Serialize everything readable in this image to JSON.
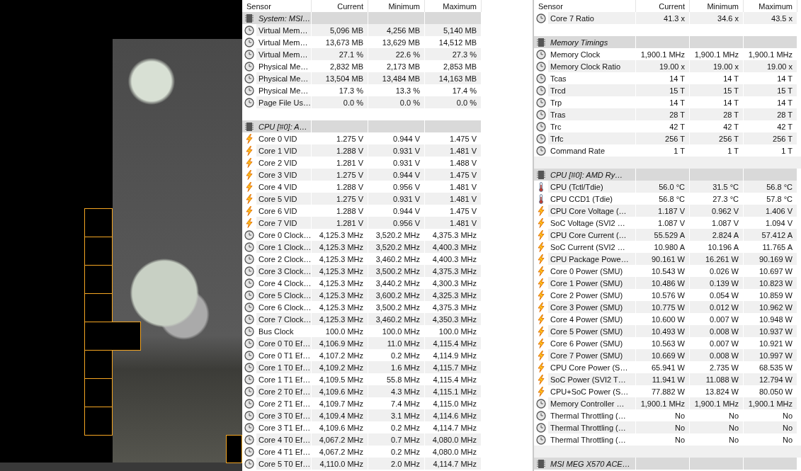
{
  "panels": [
    {
      "first_row_shaded": false,
      "columns": [
        "Sensor",
        "Current",
        "Minimum",
        "Maximum"
      ],
      "rows": [
        {
          "kind": "group",
          "name": "System: MSI…"
        },
        {
          "kind": "clock",
          "name": "Virtual Mem…",
          "current": "5,096 MB",
          "minimum": "4,256 MB",
          "maximum": "5,140 MB"
        },
        {
          "kind": "clock",
          "name": "Virtual Mem…",
          "current": "13,673 MB",
          "minimum": "13,629 MB",
          "maximum": "14,512 MB"
        },
        {
          "kind": "clock",
          "name": "Virtual Mem…",
          "current": "27.1 %",
          "minimum": "22.6 %",
          "maximum": "27.3 %"
        },
        {
          "kind": "clock",
          "name": "Physical Me…",
          "current": "2,832 MB",
          "minimum": "2,173 MB",
          "maximum": "2,853 MB"
        },
        {
          "kind": "clock",
          "name": "Physical Me…",
          "current": "13,504 MB",
          "minimum": "13,484 MB",
          "maximum": "14,163 MB"
        },
        {
          "kind": "clock",
          "name": "Physical Me…",
          "current": "17.3 %",
          "minimum": "13.3 %",
          "maximum": "17.4 %"
        },
        {
          "kind": "clock",
          "name": "Page File Us…",
          "current": "0.0 %",
          "minimum": "0.0 %",
          "maximum": "0.0 %"
        },
        {
          "kind": "blank"
        },
        {
          "kind": "group",
          "name": "CPU [#0]: A…"
        },
        {
          "kind": "voltage",
          "name": "Core 0 VID",
          "current": "1.275 V",
          "minimum": "0.944 V",
          "maximum": "1.475 V"
        },
        {
          "kind": "voltage",
          "name": "Core 1 VID",
          "current": "1.288 V",
          "minimum": "0.931 V",
          "maximum": "1.481 V"
        },
        {
          "kind": "voltage",
          "name": "Core 2 VID",
          "current": "1.281 V",
          "minimum": "0.931 V",
          "maximum": "1.488 V"
        },
        {
          "kind": "voltage",
          "name": "Core 3 VID",
          "current": "1.275 V",
          "minimum": "0.944 V",
          "maximum": "1.475 V"
        },
        {
          "kind": "voltage",
          "name": "Core 4 VID",
          "current": "1.288 V",
          "minimum": "0.956 V",
          "maximum": "1.481 V"
        },
        {
          "kind": "voltage",
          "name": "Core 5 VID",
          "current": "1.275 V",
          "minimum": "0.931 V",
          "maximum": "1.481 V"
        },
        {
          "kind": "voltage",
          "name": "Core 6 VID",
          "current": "1.288 V",
          "minimum": "0.944 V",
          "maximum": "1.475 V"
        },
        {
          "kind": "voltage",
          "name": "Core 7 VID",
          "current": "1.281 V",
          "minimum": "0.956 V",
          "maximum": "1.481 V"
        },
        {
          "kind": "clock",
          "name": "Core 0 Clock…",
          "current": "4,125.3 MHz",
          "minimum": "3,520.2 MHz",
          "maximum": "4,375.3 MHz"
        },
        {
          "kind": "clock",
          "name": "Core 1 Clock…",
          "current": "4,125.3 MHz",
          "minimum": "3,520.2 MHz",
          "maximum": "4,400.3 MHz"
        },
        {
          "kind": "clock",
          "name": "Core 2 Clock…",
          "current": "4,125.3 MHz",
          "minimum": "3,460.2 MHz",
          "maximum": "4,400.3 MHz"
        },
        {
          "kind": "clock",
          "name": "Core 3 Clock…",
          "current": "4,125.3 MHz",
          "minimum": "3,500.2 MHz",
          "maximum": "4,375.3 MHz"
        },
        {
          "kind": "clock",
          "name": "Core 4 Clock…",
          "current": "4,125.3 MHz",
          "minimum": "3,440.2 MHz",
          "maximum": "4,300.3 MHz"
        },
        {
          "kind": "clock",
          "name": "Core 5 Clock…",
          "current": "4,125.3 MHz",
          "minimum": "3,600.2 MHz",
          "maximum": "4,325.3 MHz"
        },
        {
          "kind": "clock",
          "name": "Core 6 Clock…",
          "current": "4,125.3 MHz",
          "minimum": "3,500.2 MHz",
          "maximum": "4,375.3 MHz"
        },
        {
          "kind": "clock",
          "name": "Core 7 Clock…",
          "current": "4,125.3 MHz",
          "minimum": "3,460.2 MHz",
          "maximum": "4,350.3 MHz"
        },
        {
          "kind": "clock",
          "name": "Bus Clock",
          "current": "100.0 MHz",
          "minimum": "100.0 MHz",
          "maximum": "100.0 MHz"
        },
        {
          "kind": "clock",
          "name": "Core 0 T0 Ef…",
          "current": "4,106.9 MHz",
          "minimum": "11.0 MHz",
          "maximum": "4,115.4 MHz"
        },
        {
          "kind": "clock",
          "name": "Core 0 T1 Ef…",
          "current": "4,107.2 MHz",
          "minimum": "0.2 MHz",
          "maximum": "4,114.9 MHz"
        },
        {
          "kind": "clock",
          "name": "Core 1 T0 Ef…",
          "current": "4,109.2 MHz",
          "minimum": "1.6 MHz",
          "maximum": "4,115.7 MHz"
        },
        {
          "kind": "clock",
          "name": "Core 1 T1 Ef…",
          "current": "4,109.5 MHz",
          "minimum": "55.8 MHz",
          "maximum": "4,115.4 MHz"
        },
        {
          "kind": "clock",
          "name": "Core 2 T0 Ef…",
          "current": "4,109.6 MHz",
          "minimum": "4.3 MHz",
          "maximum": "4,115.1 MHz"
        },
        {
          "kind": "clock",
          "name": "Core 2 T1 Ef…",
          "current": "4,109.7 MHz",
          "minimum": "7.4 MHz",
          "maximum": "4,115.0 MHz"
        },
        {
          "kind": "clock",
          "name": "Core 3 T0 Ef…",
          "current": "4,109.4 MHz",
          "minimum": "3.1 MHz",
          "maximum": "4,114.6 MHz"
        },
        {
          "kind": "clock",
          "name": "Core 3 T1 Ef…",
          "current": "4,109.6 MHz",
          "minimum": "0.2 MHz",
          "maximum": "4,114.7 MHz"
        },
        {
          "kind": "clock",
          "name": "Core 4 T0 Ef…",
          "current": "4,067.2 MHz",
          "minimum": "0.7 MHz",
          "maximum": "4,080.0 MHz"
        },
        {
          "kind": "clock",
          "name": "Core 4 T1 Ef…",
          "current": "4,067.2 MHz",
          "minimum": "0.2 MHz",
          "maximum": "4,080.0 MHz"
        },
        {
          "kind": "clock",
          "name": "Core 5 T0 Ef…",
          "current": "4,110.0 MHz",
          "minimum": "2.0 MHz",
          "maximum": "4,114.7 MHz"
        }
      ]
    },
    {
      "first_row_shaded": true,
      "columns": [
        "Sensor",
        "Current",
        "Minimum",
        "Maximum"
      ],
      "rows": [
        {
          "kind": "clock",
          "name": "Core 7 Ratio",
          "current": "41.3 x",
          "minimum": "34.6 x",
          "maximum": "43.5 x"
        },
        {
          "kind": "blank"
        },
        {
          "kind": "group",
          "name": "Memory Timings"
        },
        {
          "kind": "clock",
          "name": "Memory Clock",
          "current": "1,900.1 MHz",
          "minimum": "1,900.1 MHz",
          "maximum": "1,900.1 MHz"
        },
        {
          "kind": "clock",
          "name": "Memory Clock Ratio",
          "current": "19.00 x",
          "minimum": "19.00 x",
          "maximum": "19.00 x"
        },
        {
          "kind": "clock",
          "name": "Tcas",
          "current": "14 T",
          "minimum": "14 T",
          "maximum": "14 T"
        },
        {
          "kind": "clock",
          "name": "Trcd",
          "current": "15 T",
          "minimum": "15 T",
          "maximum": "15 T"
        },
        {
          "kind": "clock",
          "name": "Trp",
          "current": "14 T",
          "minimum": "14 T",
          "maximum": "14 T"
        },
        {
          "kind": "clock",
          "name": "Tras",
          "current": "28 T",
          "minimum": "28 T",
          "maximum": "28 T"
        },
        {
          "kind": "clock",
          "name": "Trc",
          "current": "42 T",
          "minimum": "42 T",
          "maximum": "42 T"
        },
        {
          "kind": "clock",
          "name": "Trfc",
          "current": "256 T",
          "minimum": "256 T",
          "maximum": "256 T"
        },
        {
          "kind": "clock",
          "name": "Command Rate",
          "current": "1 T",
          "minimum": "1 T",
          "maximum": "1 T"
        },
        {
          "kind": "blank"
        },
        {
          "kind": "group",
          "name": "CPU [#0]: AMD Ry…"
        },
        {
          "kind": "temperature",
          "name": "CPU (Tctl/Tdie)",
          "current": "56.0 °C",
          "minimum": "31.5 °C",
          "maximum": "56.8 °C"
        },
        {
          "kind": "temperature",
          "name": "CPU CCD1 (Tdie)",
          "current": "56.8 °C",
          "minimum": "27.3 °C",
          "maximum": "57.8 °C"
        },
        {
          "kind": "voltage",
          "name": "CPU Core Voltage (…",
          "current": "1.187 V",
          "minimum": "0.962 V",
          "maximum": "1.406 V"
        },
        {
          "kind": "voltage",
          "name": "SoC Voltage (SVI2 …",
          "current": "1.087 V",
          "minimum": "1.087 V",
          "maximum": "1.094 V"
        },
        {
          "kind": "voltage",
          "name": "CPU Core Current (…",
          "current": "55.529 A",
          "minimum": "2.824 A",
          "maximum": "57.412 A"
        },
        {
          "kind": "voltage",
          "name": "SoC Current (SVI2 …",
          "current": "10.980 A",
          "minimum": "10.196 A",
          "maximum": "11.765 A"
        },
        {
          "kind": "voltage",
          "name": "CPU Package Powe…",
          "current": "90.161 W",
          "minimum": "16.261 W",
          "maximum": "90.169 W"
        },
        {
          "kind": "voltage",
          "name": "Core 0 Power (SMU)",
          "current": "10.543 W",
          "minimum": "0.026 W",
          "maximum": "10.697 W"
        },
        {
          "kind": "voltage",
          "name": "Core 1 Power (SMU)",
          "current": "10.486 W",
          "minimum": "0.139 W",
          "maximum": "10.823 W"
        },
        {
          "kind": "voltage",
          "name": "Core 2 Power (SMU)",
          "current": "10.576 W",
          "minimum": "0.054 W",
          "maximum": "10.859 W"
        },
        {
          "kind": "voltage",
          "name": "Core 3 Power (SMU)",
          "current": "10.775 W",
          "minimum": "0.012 W",
          "maximum": "10.962 W"
        },
        {
          "kind": "voltage",
          "name": "Core 4 Power (SMU)",
          "current": "10.600 W",
          "minimum": "0.007 W",
          "maximum": "10.948 W"
        },
        {
          "kind": "voltage",
          "name": "Core 5 Power (SMU)",
          "current": "10.493 W",
          "minimum": "0.008 W",
          "maximum": "10.937 W"
        },
        {
          "kind": "voltage",
          "name": "Core 6 Power (SMU)",
          "current": "10.563 W",
          "minimum": "0.007 W",
          "maximum": "10.921 W"
        },
        {
          "kind": "voltage",
          "name": "Core 7 Power (SMU)",
          "current": "10.669 W",
          "minimum": "0.008 W",
          "maximum": "10.997 W"
        },
        {
          "kind": "voltage",
          "name": "CPU Core Power (S…",
          "current": "65.941 W",
          "minimum": "2.735 W",
          "maximum": "68.535 W"
        },
        {
          "kind": "voltage",
          "name": "SoC Power (SVI2 T…",
          "current": "11.941 W",
          "minimum": "11.088 W",
          "maximum": "12.794 W"
        },
        {
          "kind": "voltage",
          "name": "CPU+SoC Power (S…",
          "current": "77.882 W",
          "minimum": "13.824 W",
          "maximum": "80.050 W"
        },
        {
          "kind": "clock",
          "name": "Memory Controller …",
          "current": "1,900.1 MHz",
          "minimum": "1,900.1 MHz",
          "maximum": "1,900.1 MHz"
        },
        {
          "kind": "clock",
          "name": "Thermal Throttling (…",
          "current": "No",
          "minimum": "No",
          "maximum": "No"
        },
        {
          "kind": "clock",
          "name": "Thermal Throttling (…",
          "current": "No",
          "minimum": "No",
          "maximum": "No"
        },
        {
          "kind": "clock",
          "name": "Thermal Throttling (…",
          "current": "No",
          "minimum": "No",
          "maximum": "No"
        },
        {
          "kind": "blank"
        },
        {
          "kind": "group",
          "name": "MSI MEG X570 ACE…"
        }
      ]
    }
  ]
}
